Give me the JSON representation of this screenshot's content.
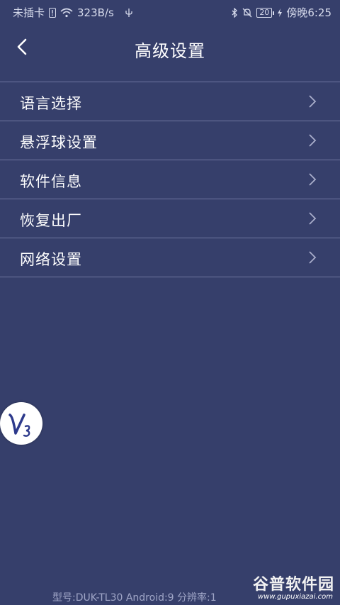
{
  "status_bar": {
    "carrier": "未插卡",
    "speed": "323B/s",
    "battery": "20",
    "time": "傍晚6:25"
  },
  "header": {
    "title": "高级设置"
  },
  "menu": {
    "items": [
      {
        "label": "语言选择"
      },
      {
        "label": "悬浮球设置"
      },
      {
        "label": "软件信息"
      },
      {
        "label": "恢复出厂"
      },
      {
        "label": "网络设置"
      }
    ]
  },
  "footer": {
    "info": "型号:DUK-TL30    Android:9    分辨率:1"
  },
  "watermark": {
    "main": "谷普软件园",
    "sub": "www.gupuxiazai.com"
  },
  "colors": {
    "background": "#363f6b",
    "divider": "#6f76a0",
    "text": "#ffffff"
  }
}
